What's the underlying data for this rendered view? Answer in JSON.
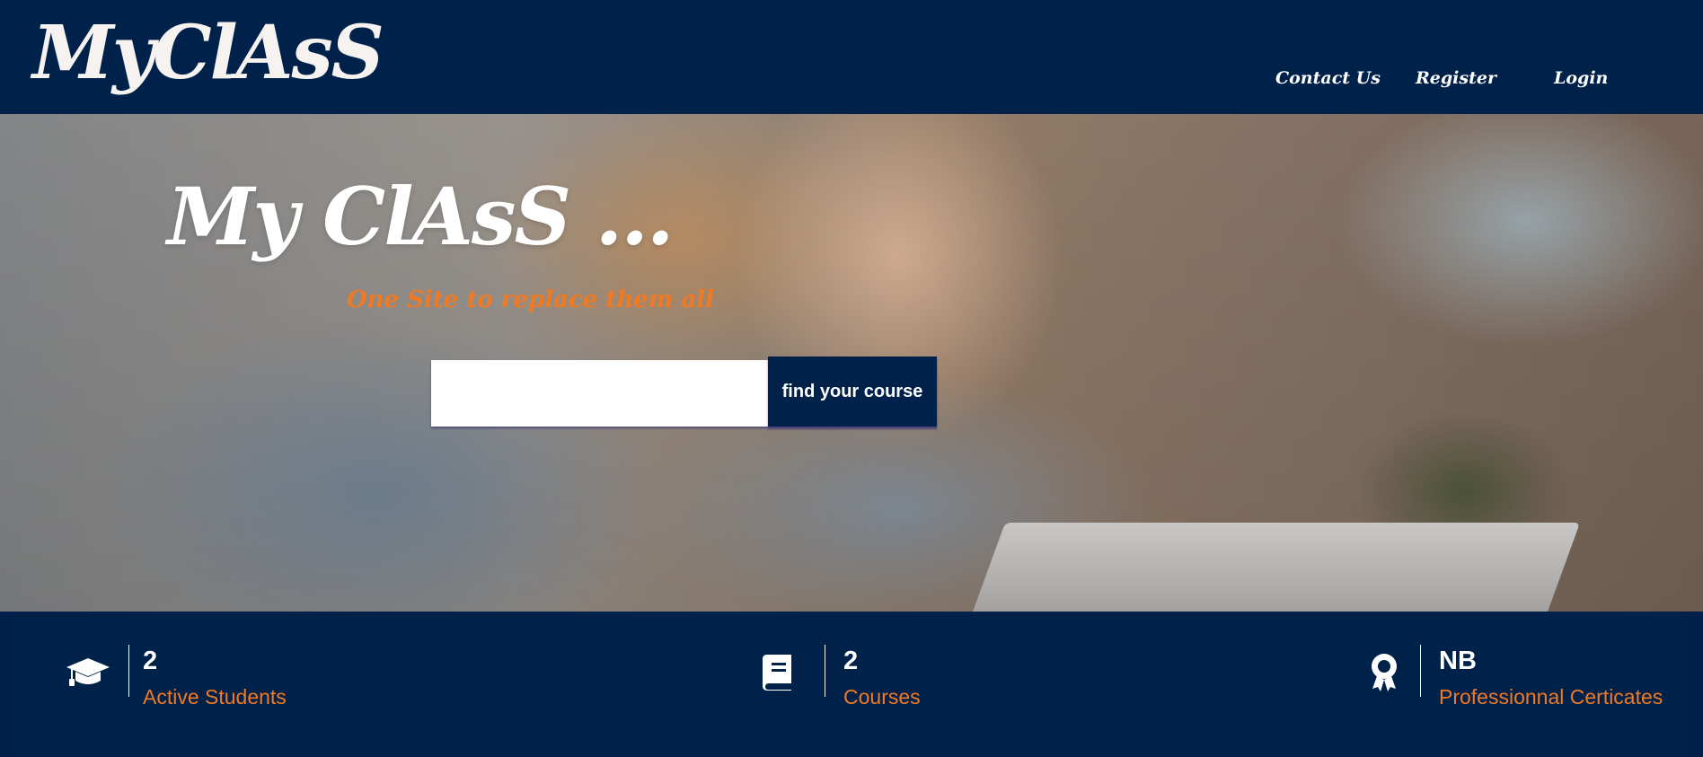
{
  "header": {
    "logo": "MyClAsS",
    "nav": {
      "contact": "Contact Us",
      "register": "Register",
      "login": "Login"
    }
  },
  "hero": {
    "title": "My ClAsS ...",
    "subtitle": "One Site to replace them all",
    "search": {
      "value": "",
      "placeholder": "",
      "button_label": "find your course"
    }
  },
  "stats": [
    {
      "icon": "graduation-cap-icon",
      "value": "2",
      "label": "Active Students"
    },
    {
      "icon": "book-icon",
      "value": "2",
      "label": "Courses"
    },
    {
      "icon": "award-ribbon-icon",
      "value": "NB",
      "label": "Professionnal Certicates"
    }
  ],
  "colors": {
    "navy": "#00214a",
    "accent_orange": "#f07a24",
    "white": "#ffffff"
  }
}
